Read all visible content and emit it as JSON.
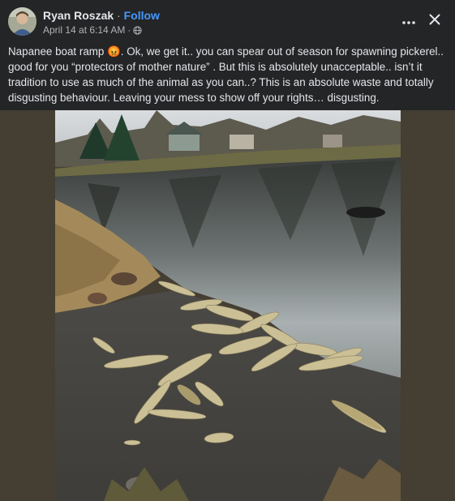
{
  "post": {
    "author": "Ryan Roszak",
    "separator": "·",
    "follow_label": "Follow",
    "timestamp": "April 14 at 6:14 AM",
    "meta_separator": "·",
    "privacy_icon": "globe-icon",
    "text": "Napanee boat ramp 😡. Ok, we get it.. you can spear out of season for spawning pickerel.. good for you “protectors of mother nature”  .  But this is absolutely unacceptable.. isn’t it tradition to use as much of the animal as you can..?  This is an absolute waste and totally disgusting behaviour. Leaving your mess to show off your rights… disgusting."
  },
  "header_actions": {
    "more_icon": "more-options-icon",
    "close_icon": "close-icon"
  },
  "colors": {
    "background": "#242526",
    "primary_text": "#e4e6eb",
    "secondary_text": "#b0b3b8",
    "accent": "#4599ff",
    "photo_backdrop": "#443e33"
  }
}
